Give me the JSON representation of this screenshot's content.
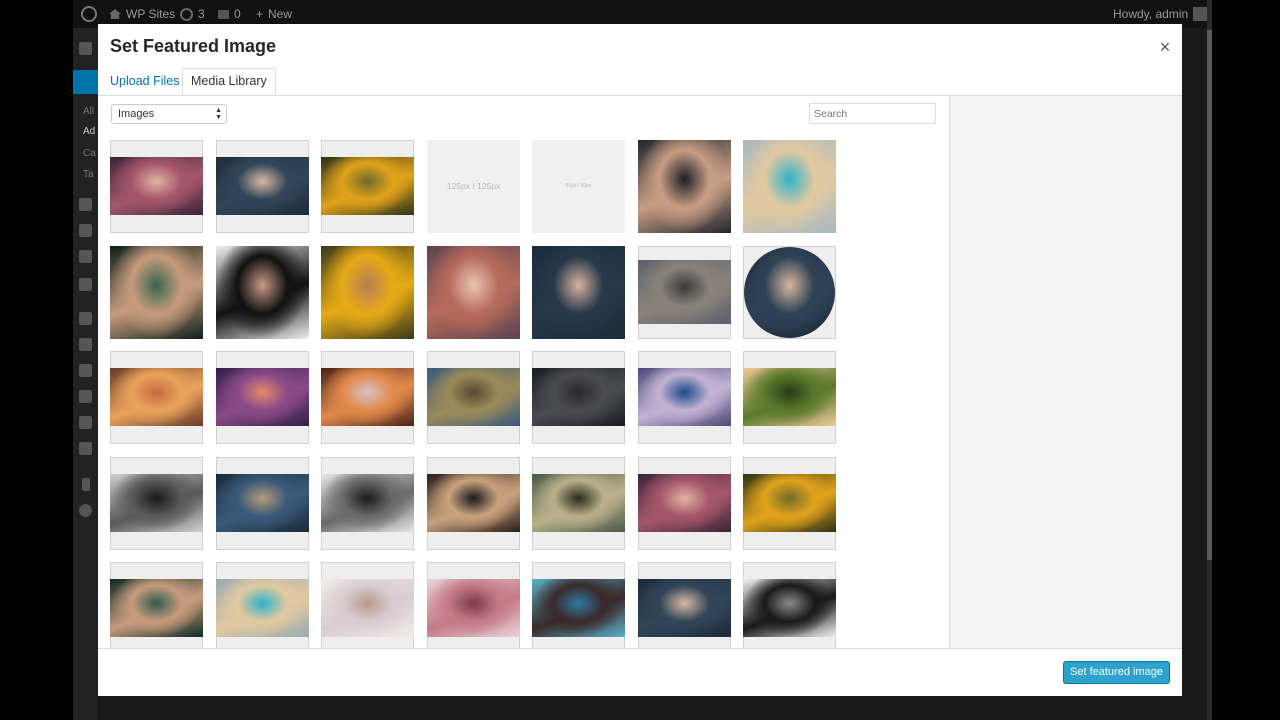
{
  "admin_bar": {
    "site_name": "WP Sites",
    "updates_count": "3",
    "comments_count": "0",
    "new_label": "New",
    "greeting": "Howdy, admin"
  },
  "admin_menu": {
    "items": [
      "All",
      "Ad",
      "Ca",
      "Ta"
    ]
  },
  "modal": {
    "title": "Set Featured Image",
    "close_icon": "×",
    "tabs": [
      "Upload Files",
      "Media Library"
    ],
    "active_tab": "Media Library",
    "filter": {
      "selected": "Images",
      "arrows": "▲▼"
    },
    "search": {
      "placeholder": "Search"
    },
    "primary_button": "Set featured image"
  },
  "media_grid": {
    "columns": 7,
    "items": [
      {
        "name": "woman-portrait-purple",
        "c": [
          "#3a2438",
          "#a5576a",
          "#e1b2a2"
        ],
        "fit": "wide"
      },
      {
        "name": "man-dare-tshirt",
        "c": [
          "#1d2b3a",
          "#324659",
          "#d9b9a2"
        ],
        "fit": "wide"
      },
      {
        "name": "man-yellow-hoodie",
        "c": [
          "#2c3319",
          "#e0a21a",
          "#706b2c"
        ],
        "fit": "wide"
      },
      {
        "name": "placeholder-125px",
        "ph": "125px / 125px"
      },
      {
        "name": "placeholder-small",
        "ph": "50px / 50px"
      },
      {
        "name": "man-portrait-dark",
        "c": [
          "#20262e",
          "#c79d84",
          "#1b1f24"
        ],
        "fit": "full"
      },
      {
        "name": "blonde-woman-window",
        "c": [
          "#a8b9c2",
          "#e1c9a0",
          "#2fb2cc"
        ],
        "fit": "full"
      },
      {
        "name": "man-green-portrait",
        "c": [
          "#0c1f1a",
          "#c69b7c",
          "#39664f"
        ],
        "fit": "full"
      },
      {
        "name": "woman-headphones-bw",
        "c": [
          "#efefef",
          "#111111",
          "#c89a86"
        ],
        "fit": "full"
      },
      {
        "name": "man-yellow-hood-closeup",
        "c": [
          "#3b3a1a",
          "#e5aa16",
          "#b87d55"
        ],
        "fit": "full"
      },
      {
        "name": "woman-portrait-full",
        "c": [
          "#5c4450",
          "#b66a5a",
          "#e9c6b2"
        ],
        "fit": "full"
      },
      {
        "name": "man-dare-full",
        "c": [
          "#1d2b3a",
          "#263849",
          "#d7b39f"
        ],
        "fit": "full"
      },
      {
        "name": "landscape-strip",
        "c": [
          "#5c6170",
          "#8a8279",
          "#3b3a3c"
        ],
        "fit": "mid"
      },
      {
        "name": "man-dare-circle",
        "c": [
          "#1c2838",
          "#2f4356",
          "#d9b69d"
        ],
        "fit": "circle"
      },
      {
        "name": "sunlit-colonnade",
        "c": [
          "#6a3b2a",
          "#e9a25a",
          "#c46b3e"
        ],
        "fit": "wide"
      },
      {
        "name": "purple-beach-sunset",
        "c": [
          "#30204a",
          "#8a4a86",
          "#e38a6a"
        ],
        "fit": "wide"
      },
      {
        "name": "snowy-sunrise-mountains",
        "c": [
          "#4a2418",
          "#e1894a",
          "#d7c1c8"
        ],
        "fit": "wide"
      },
      {
        "name": "mountain-valley-lake",
        "c": [
          "#3a5a7a",
          "#9a8a5a",
          "#5a4a32"
        ],
        "fit": "wide"
      },
      {
        "name": "dark-lake-dusk",
        "c": [
          "#1a1c24",
          "#4a4a52",
          "#2a2a2c"
        ],
        "fit": "wide"
      },
      {
        "name": "icy-river-rocks",
        "c": [
          "#4a4a7a",
          "#c3b2d2",
          "#1a4a8a"
        ],
        "fit": "wide"
      },
      {
        "name": "green-hills-sunset",
        "c": [
          "#f0c89a",
          "#5a7a2a",
          "#2a3a1a"
        ],
        "fit": "wide"
      },
      {
        "name": "bw-castle-sea",
        "c": [
          "#cfcfcf",
          "#5a5a5a",
          "#1a1a1a"
        ],
        "fit": "wide"
      },
      {
        "name": "blue-beach-dusk",
        "c": [
          "#1a2a3a",
          "#3a5a7a",
          "#b89a7a"
        ],
        "fit": "wide"
      },
      {
        "name": "bw-rocky-shore",
        "c": [
          "#e5e5e5",
          "#6a6a6a",
          "#1a1a1a"
        ],
        "fit": "wide"
      },
      {
        "name": "pier-silhouette",
        "c": [
          "#2a1c1a",
          "#c9a27c",
          "#1a1a1e"
        ],
        "fit": "wide"
      },
      {
        "name": "mountain-creek",
        "c": [
          "#4a5a4a",
          "#b9b08a",
          "#2a2a1e"
        ],
        "fit": "wide"
      },
      {
        "name": "woman-portrait-wide",
        "c": [
          "#3a2438",
          "#a5576a",
          "#e1b2a2"
        ],
        "fit": "wide"
      },
      {
        "name": "man-yellow-hoodie-wide",
        "c": [
          "#2c3319",
          "#e0a21a",
          "#706b2c"
        ],
        "fit": "wide"
      },
      {
        "name": "man-green-portrait-wide",
        "c": [
          "#0c2a24",
          "#c69b7c",
          "#2f5a4f"
        ],
        "fit": "wide"
      },
      {
        "name": "blonde-woman-wide",
        "c": [
          "#9aaab2",
          "#e1c9a0",
          "#2fb2cc"
        ],
        "fit": "wide"
      },
      {
        "name": "woman-snow-light",
        "c": [
          "#f2ece8",
          "#d8ccd0",
          "#b89a8a"
        ],
        "fit": "wide"
      },
      {
        "name": "woman-sun-flare",
        "c": [
          "#e9d3d8",
          "#c47a86",
          "#7a3a4a"
        ],
        "fit": "wide"
      },
      {
        "name": "coastal-cliffs",
        "c": [
          "#5ab0c8",
          "#3a2a2a",
          "#2f7aa0"
        ],
        "fit": "wide"
      },
      {
        "name": "man-dare-wide",
        "c": [
          "#1d2b3a",
          "#324659",
          "#d9b9a2"
        ],
        "fit": "wide"
      },
      {
        "name": "woman-headphones-bw-wide",
        "c": [
          "#efefef",
          "#1a1a1a",
          "#8a8a8a"
        ],
        "fit": "wide"
      }
    ]
  }
}
